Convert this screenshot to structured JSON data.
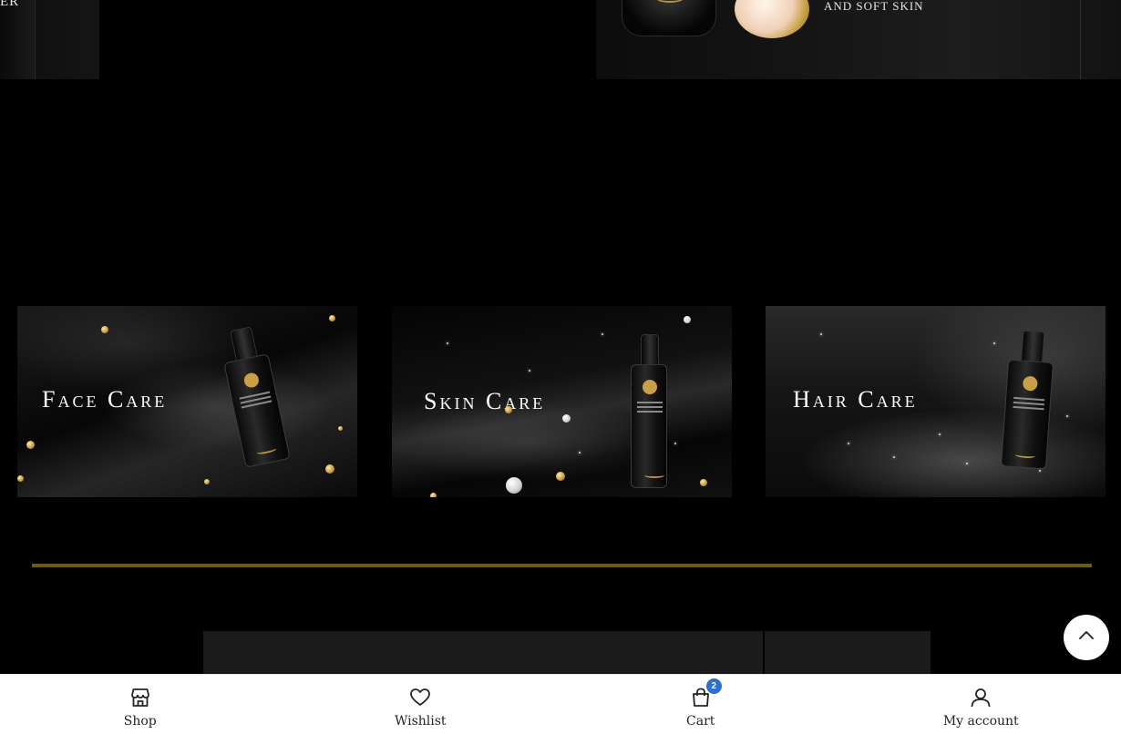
{
  "hero": {
    "left_text": "ER",
    "right_tagline": "AND SOFT SKIN"
  },
  "categories": [
    {
      "title": "Face Care"
    },
    {
      "title": "Skin Care"
    },
    {
      "title": "Hair Care"
    }
  ],
  "colors": {
    "background": "#000000",
    "accent_gold": "#6e5a18",
    "badge_blue": "#2b6fd1"
  },
  "bottom_nav": {
    "shop": "Shop",
    "wishlist": "Wishlist",
    "cart": "Cart",
    "cart_count": "2",
    "account": "My account"
  },
  "icons": {
    "shop": "store-icon",
    "wishlist": "heart-icon",
    "cart": "shopping-bag-icon",
    "account": "user-icon",
    "scroll_top": "chevron-up-icon"
  }
}
